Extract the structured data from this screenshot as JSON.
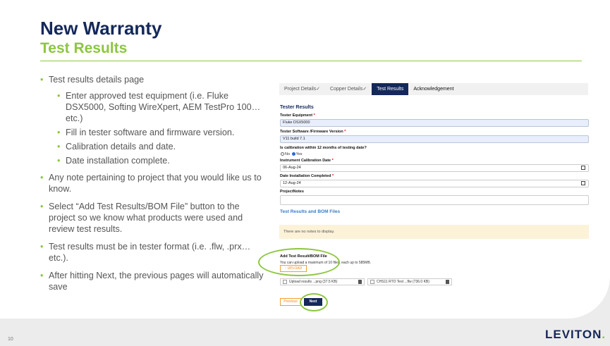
{
  "slide": {
    "title": "New Warranty",
    "subtitle": "Test Results",
    "page_number": "10",
    "logo_text": "LEVITON",
    "logo_dot": ".",
    "colors": {
      "navy": "#14285a",
      "green": "#8dc63f",
      "orange": "#f08a20"
    }
  },
  "bullets": {
    "b1": "Test results details page",
    "b1_subs": [
      "Enter approved test equipment (i.e. Fluke DSX5000, Softing WireXpert, AEM TestPro 100…etc.)",
      "Fill in tester software and firmware version.",
      "Calibration details and date.",
      "Date installation complete."
    ],
    "b2": "Any note pertaining to project that you would like us to know.",
    "b3": "Select “Add Test Results/BOM File” button to the project so we know what products were used and review test results.",
    "b4": "Test results must be in tester format (i.e. .flw, .prx…etc.).",
    "b5": "After hitting Next, the previous pages will automatically save"
  },
  "app": {
    "tabs": [
      {
        "label": "Project Details",
        "check": "✓"
      },
      {
        "label": "Copper Details",
        "check": "✓"
      },
      {
        "label": "Test Results"
      },
      {
        "label": "Acknowledgement"
      }
    ],
    "section_title": "Tester Results",
    "tester_equipment_label": "Tester Equipment",
    "tester_equipment_value": "Fluke DSX5000",
    "software_label": "Tester Software /Firmware Version",
    "software_value": "V11 build 7.1",
    "calibration_question": "Is calibration within 12 months of testing date?",
    "radio_no": "No",
    "radio_yes": "Yes",
    "calibration_date_label": "Instrument Calibration Date",
    "calibration_date_value": "06-Aug-24",
    "install_date_label": "Date Installation Completed",
    "install_date_value": "12-Aug-24",
    "notes_label": "ProjectNotes",
    "required_mark": "*",
    "results_bom_heading": "Test Results and BOM Files",
    "empty_notes": "There are no notes to display.",
    "add_title": "Add Test Result/BOM File",
    "add_subtitle": "You can upload a maximum of 10 files, each up to 585MB.",
    "upload_button": "↑ UPLOAD",
    "files": [
      {
        "name": "Upload results ...png (37.5 KB)"
      },
      {
        "name": "CHS11 RTO Test ...flw (736.0 KB)"
      }
    ],
    "previous_button": "Previous",
    "next_button": "Next"
  }
}
